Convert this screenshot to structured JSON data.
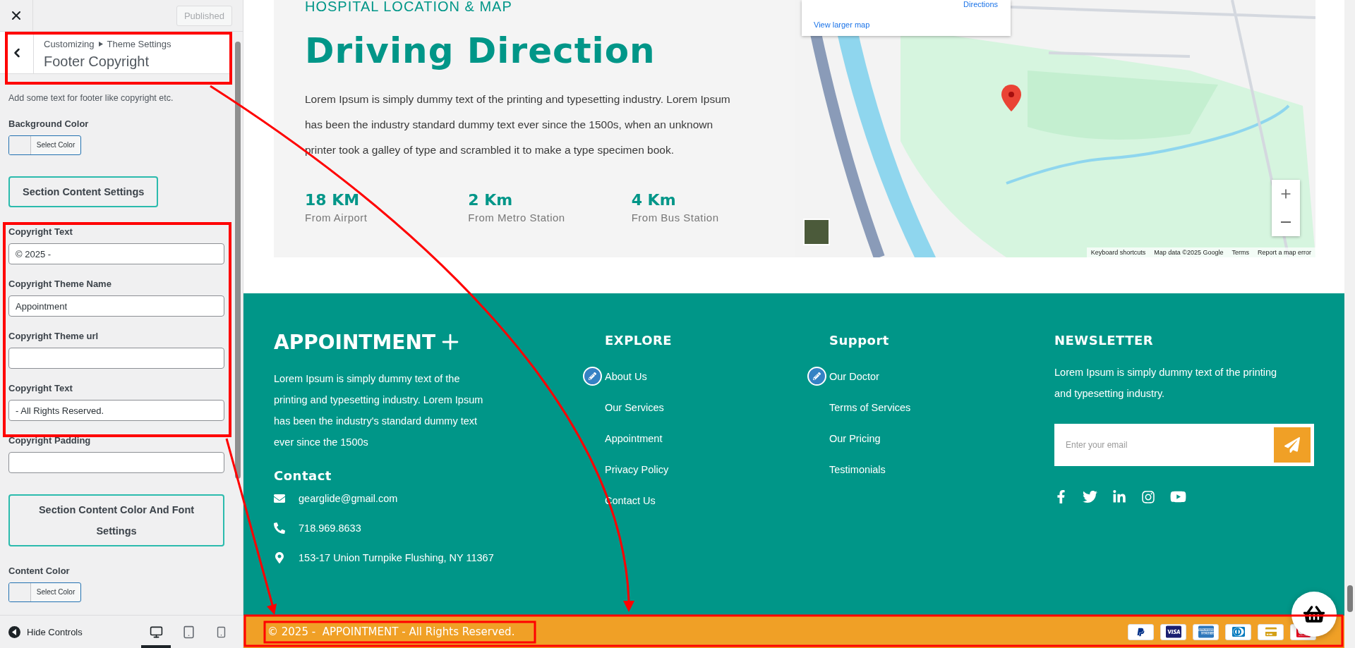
{
  "customizer": {
    "publish_button": {
      "label": "Published",
      "disabled": true
    },
    "breadcrumb": [
      "Customizing",
      "Theme Settings"
    ],
    "title": "Footer Copyright",
    "description": "Add some text for footer like copyright etc.",
    "controls": [
      {
        "kind": "color",
        "label": "Background Color",
        "button": "Select Color"
      },
      {
        "kind": "section",
        "label": "Section Content Settings"
      },
      {
        "kind": "text",
        "label": "Copyright Text",
        "value": "© 2025 -"
      },
      {
        "kind": "text",
        "label": "Copyright Theme Name",
        "value": "Appointment"
      },
      {
        "kind": "text",
        "label": "Copyright Theme url"
      },
      {
        "kind": "text",
        "label": "Copyright Text",
        "value": "- All Rights Reserved."
      },
      {
        "kind": "text",
        "label": "Copyright Padding"
      },
      {
        "kind": "section",
        "label": "Section Content Color And Font Settings"
      },
      {
        "kind": "color",
        "label": "Content Color",
        "button": "Select Color"
      }
    ],
    "hide_controls": "Hide Controls",
    "devices": [
      {
        "kind": "desktop",
        "selected": true
      },
      {
        "kind": "tablet",
        "selected": false
      },
      {
        "kind": "mobile",
        "selected": false
      }
    ]
  },
  "location": {
    "eyebrow": "HOSPITAL LOCATION & MAP",
    "title": "Driving Direction",
    "body": "Lorem Ipsum is simply dummy text of the printing and typesetting industry. Lorem Ipsum has been the industry standard dummy text ever since the 1500s, when an unknown printer took a galley of type and scrambled it to make a type specimen book.",
    "stats": [
      {
        "value": "18 KM",
        "label": "From Airport"
      },
      {
        "value": "2 Km",
        "label": "From Metro Station"
      },
      {
        "value": "4 Km",
        "label": "From Bus Station"
      }
    ]
  },
  "map": {
    "directions": "Directions",
    "link": "View larger map",
    "attribution": [
      "Keyboard shortcuts",
      "Map data ©2025 Google",
      "Terms",
      "Report a map error"
    ]
  },
  "footer": {
    "brand": "APPOINTMENT",
    "about": "Lorem Ipsum is simply dummy text of the printing and typesetting industry. Lorem Ipsum has been the industry's standard dummy text ever since the 1500s",
    "contact_title": "Contact",
    "contacts": [
      {
        "kind": "email",
        "text": "gearglide@gmail.com"
      },
      {
        "kind": "phone",
        "text": "718.969.8633"
      },
      {
        "kind": "address",
        "text": "153-17 Union Turnpike Flushing, NY 11367"
      }
    ],
    "columns": [
      {
        "title": "EXPLORE",
        "links": [
          "About Us",
          "Our Services",
          "Appointment",
          "Privacy Policy",
          "Contact Us"
        ]
      },
      {
        "title": "Support",
        "links": [
          "Our Doctor",
          "Terms of Services",
          "Our Pricing",
          "Testimonials"
        ]
      }
    ],
    "newsletter": {
      "title": "NEWSLETTER",
      "text": "Lorem Ipsum is simply dummy text of the printing and typesetting industry.",
      "placeholder": "Enter your email"
    },
    "copyright": "© 2025 -  APPOINTMENT - All Rights Reserved."
  }
}
